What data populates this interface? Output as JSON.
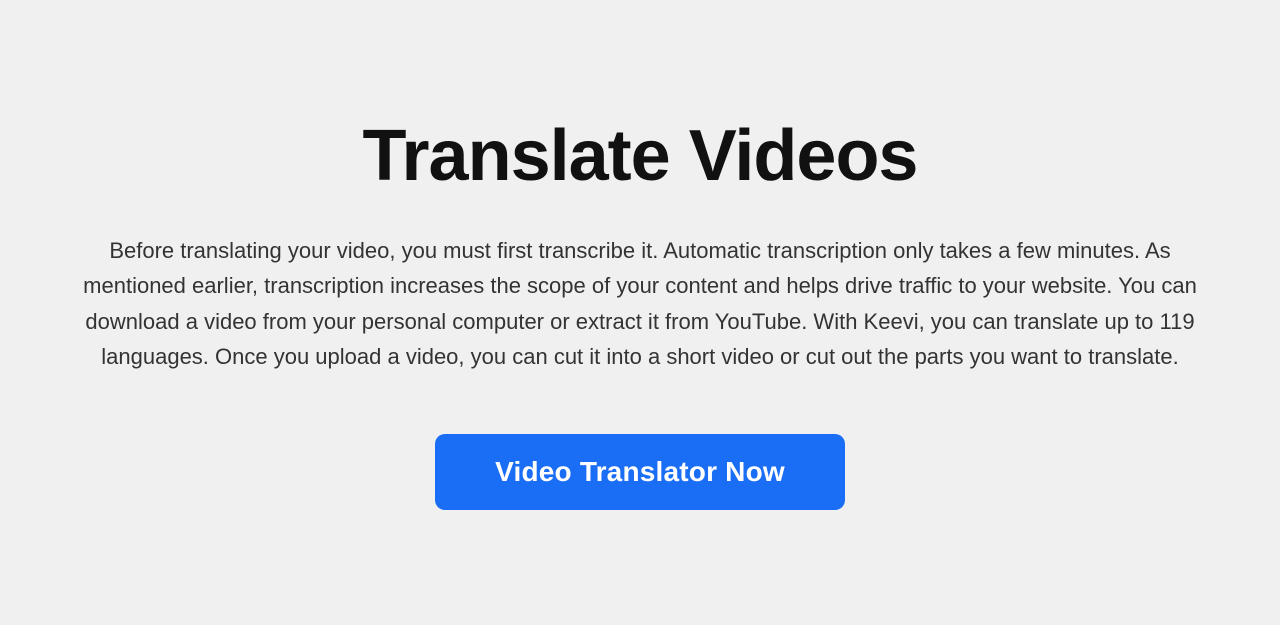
{
  "page": {
    "background_color": "#f0f0f0",
    "title": "Translate Videos",
    "description": "Before translating your video, you must first transcribe it. Automatic transcription only takes a few minutes. As mentioned earlier, transcription increases the scope of your content and helps drive traffic to your website. You can download a video from your personal computer or extract it from YouTube. With Keevi, you can translate up to 119 languages. Once you upload a video, you can cut it into a short video or cut out the parts you want to translate.",
    "cta_button_label": "Video Translator Now",
    "cta_button_color": "#1a6ef5",
    "cta_button_text_color": "#ffffff"
  }
}
